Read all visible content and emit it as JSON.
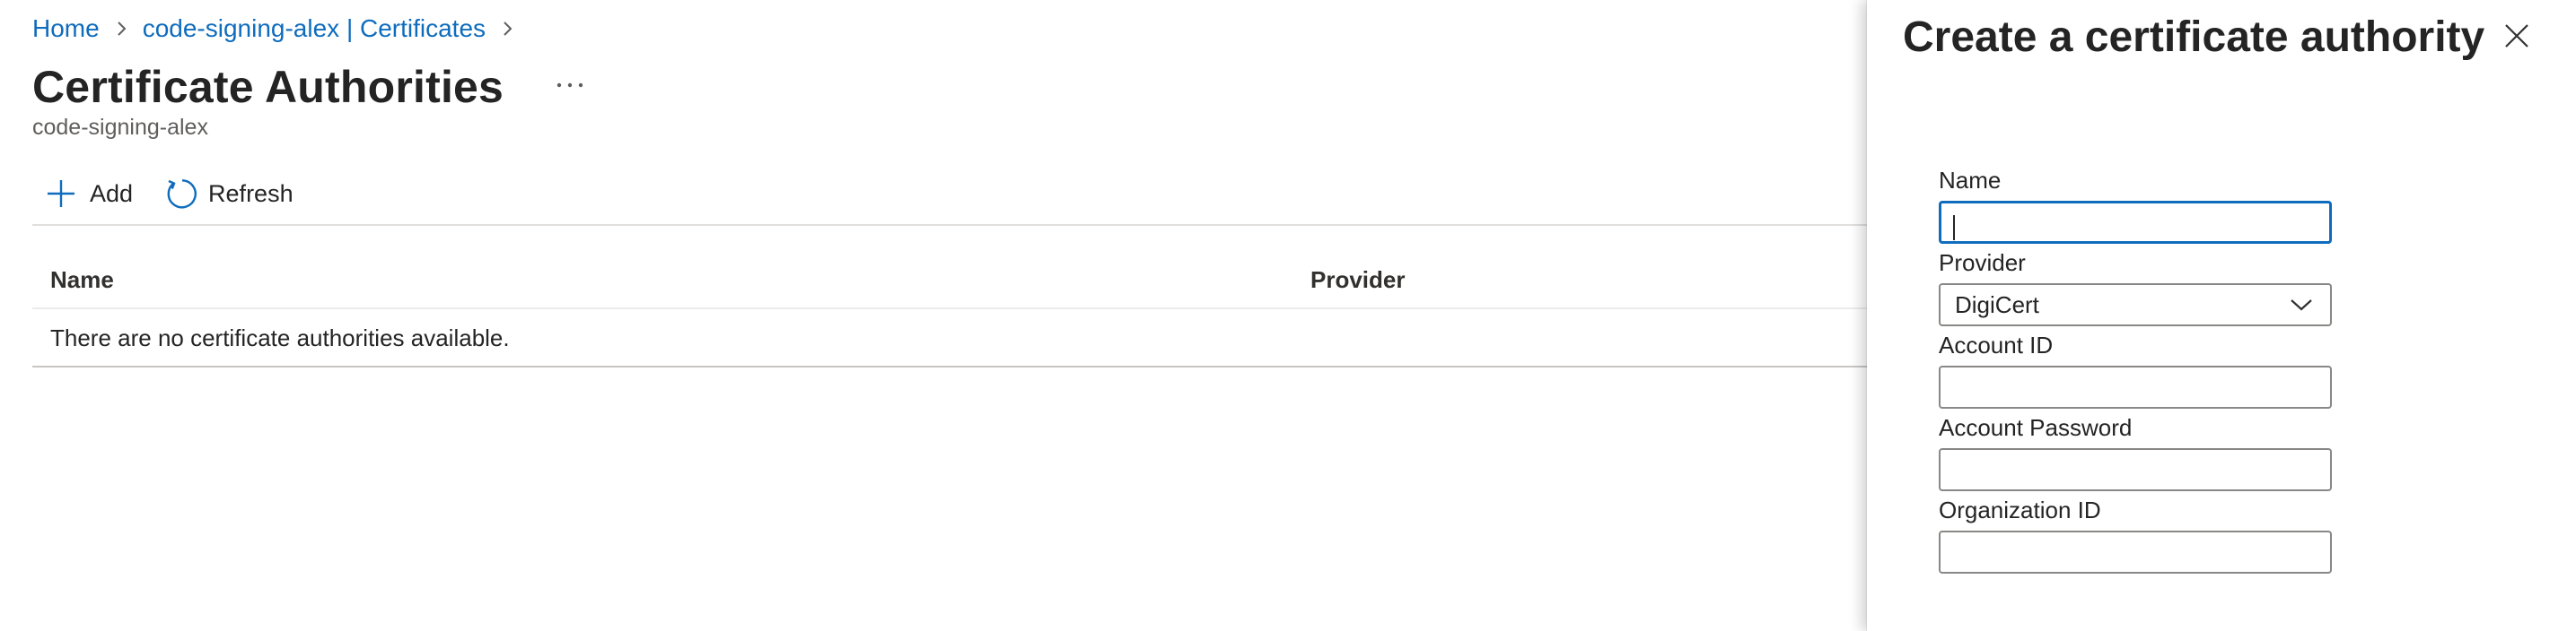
{
  "breadcrumb": {
    "items": [
      {
        "label": "Home"
      },
      {
        "label": "code-signing-alex | Certificates"
      }
    ]
  },
  "page": {
    "title": "Certificate Authorities",
    "subtitle": "code-signing-alex",
    "more_icon": "ellipsis-icon"
  },
  "toolbar": {
    "add_label": "Add",
    "add_icon": "plus-icon",
    "refresh_label": "Refresh",
    "refresh_icon": "refresh-icon"
  },
  "grid": {
    "columns": [
      "Name",
      "Provider"
    ],
    "empty_message": "There are no certificate authorities available."
  },
  "panel": {
    "title": "Create a certificate authority",
    "close_icon": "close-icon",
    "fields": {
      "name": {
        "label": "Name",
        "value": ""
      },
      "provider": {
        "label": "Provider",
        "value": "DigiCert"
      },
      "account_id": {
        "label": "Account ID",
        "value": ""
      },
      "account_password": {
        "label": "Account Password",
        "value": ""
      },
      "organization_id": {
        "label": "Organization ID",
        "value": ""
      }
    }
  },
  "colors": {
    "accent": "#0f6cbd",
    "text": "#242424",
    "border": "#8a8886"
  }
}
